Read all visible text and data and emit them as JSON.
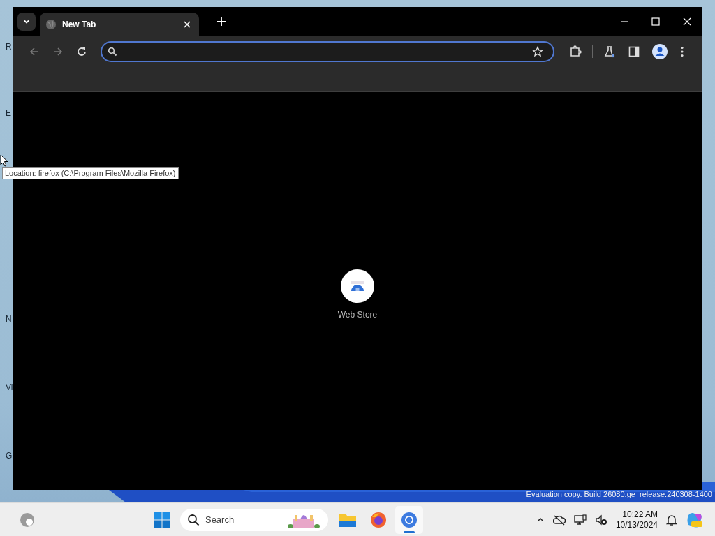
{
  "desktop_icons": [
    {
      "label": "R"
    },
    {
      "label": "E"
    },
    {
      "label": "N"
    },
    {
      "label": "Vi"
    },
    {
      "label": "G"
    }
  ],
  "browser": {
    "tabs": [
      {
        "title": "New Tab",
        "selected": true
      }
    ],
    "address_bar": {
      "focused": true
    },
    "shortcuts": [
      {
        "label": "Web Store"
      }
    ]
  },
  "tooltip": "Location: firefox (C:\\Program Files\\Mozilla Firefox)",
  "watermark": "Evaluation copy. Build 26080.ge_release.240308-1400",
  "taskbar": {
    "search": {
      "placeholder": "Search"
    },
    "apps": [
      {
        "kind": "folder",
        "selected": false
      },
      {
        "kind": "firefox",
        "selected": false
      },
      {
        "kind": "chrome",
        "selected": true
      }
    ],
    "time": "10:22 AM",
    "date": "10/13/2024"
  }
}
